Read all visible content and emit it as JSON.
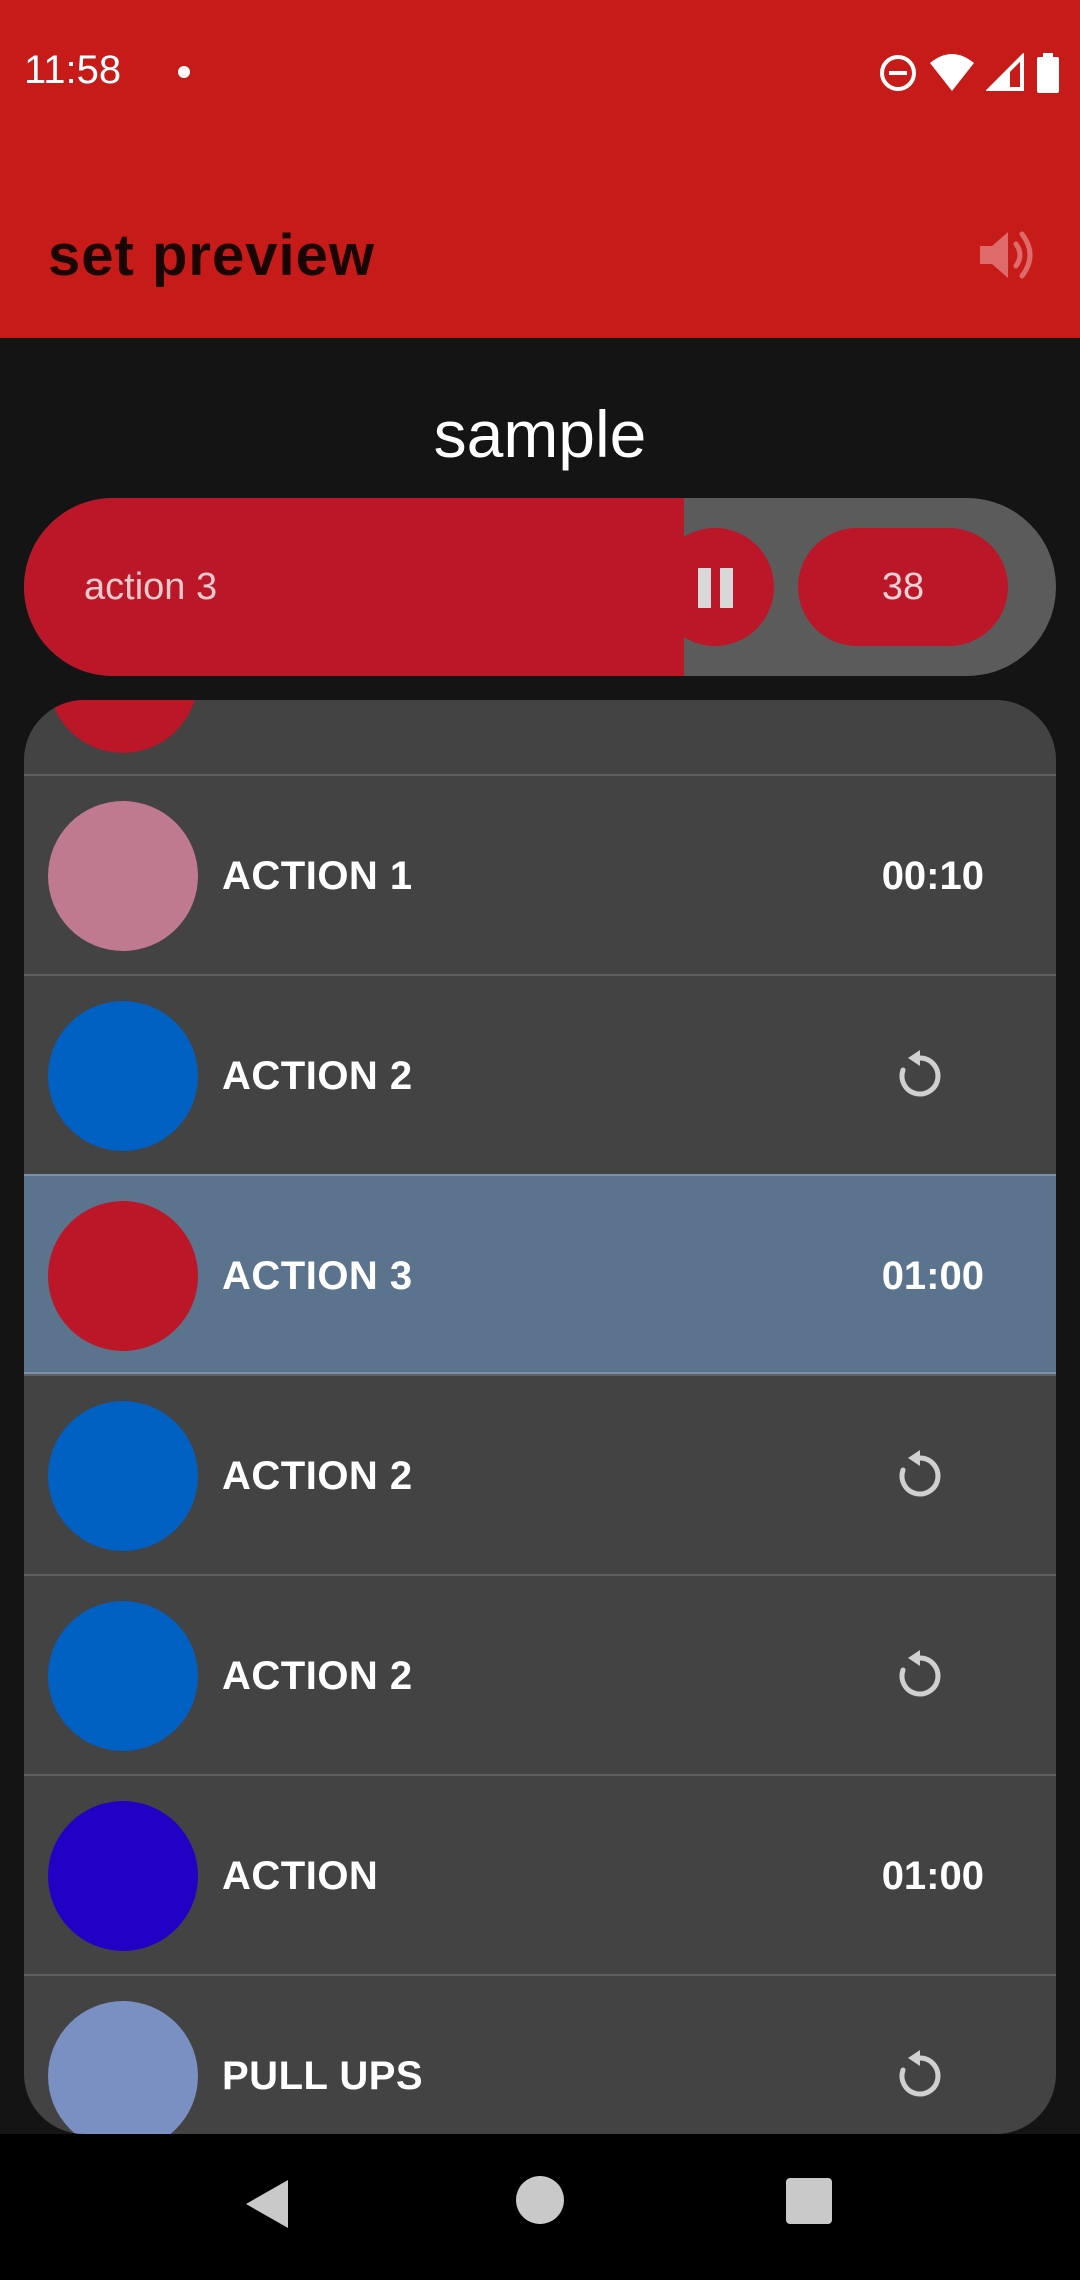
{
  "status_bar": {
    "time": "11:58"
  },
  "app_bar": {
    "title": "set preview",
    "sound_icon": "volume-icon"
  },
  "set": {
    "name": "sample"
  },
  "player": {
    "current_action": "action 3",
    "counter": "38",
    "progress_fraction": 0.64,
    "pause_icon": "pause-icon"
  },
  "actions": [
    {
      "name": "",
      "duration": "",
      "color": "#bb1728"
    },
    {
      "name": "ACTION 1",
      "duration": "00:10",
      "color": "#c07a8f"
    },
    {
      "name": "ACTION 2",
      "duration": "",
      "icon": "repeat-icon",
      "color": "#0061c3"
    },
    {
      "name": "ACTION 3",
      "duration": "01:00",
      "color": "#bb1728",
      "active": true
    },
    {
      "name": "ACTION 2",
      "duration": "",
      "icon": "repeat-icon",
      "color": "#0061c3"
    },
    {
      "name": "ACTION 2",
      "duration": "",
      "icon": "repeat-icon",
      "color": "#0061c3"
    },
    {
      "name": "ACTION",
      "duration": "01:00",
      "color": "#2200c4"
    },
    {
      "name": "PULL UPS",
      "duration": "",
      "icon": "repeat-icon",
      "color": "#7a8fc2"
    }
  ],
  "colors": {
    "app_bar": "#c61b18",
    "accent": "#bb1728",
    "active_row": "#5b738d",
    "panel": "#434343",
    "background": "#141414"
  }
}
